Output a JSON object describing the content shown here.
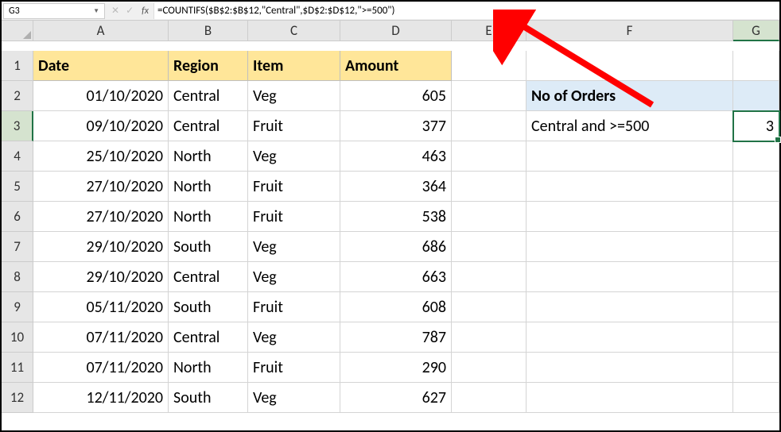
{
  "nameBox": "G3",
  "formula": "=COUNTIFS($B$2:$B$12,\"Central\",$D$2:$D$12,\">=500\")",
  "fxLabel": "fx",
  "cancelIcon": "✕",
  "enterIcon": "✓",
  "columns": [
    "A",
    "B",
    "C",
    "D",
    "E",
    "F",
    "G"
  ],
  "rows": [
    "1",
    "2",
    "3",
    "4",
    "5",
    "6",
    "7",
    "8",
    "9",
    "10",
    "11",
    "12"
  ],
  "headers": {
    "date": "Date",
    "region": "Region",
    "item": "Item",
    "amount": "Amount"
  },
  "data": [
    {
      "date": "01/10/2020",
      "region": "Central",
      "item": "Veg",
      "amount": "605"
    },
    {
      "date": "09/10/2020",
      "region": "Central",
      "item": "Fruit",
      "amount": "377"
    },
    {
      "date": "25/10/2020",
      "region": "North",
      "item": "Veg",
      "amount": "463"
    },
    {
      "date": "27/10/2020",
      "region": "North",
      "item": "Fruit",
      "amount": "364"
    },
    {
      "date": "27/10/2020",
      "region": "North",
      "item": "Fruit",
      "amount": "538"
    },
    {
      "date": "29/10/2020",
      "region": "South",
      "item": "Veg",
      "amount": "686"
    },
    {
      "date": "29/10/2020",
      "region": "Central",
      "item": "Veg",
      "amount": "663"
    },
    {
      "date": "05/11/2020",
      "region": "South",
      "item": "Fruit",
      "amount": "608"
    },
    {
      "date": "07/11/2020",
      "region": "Central",
      "item": "Veg",
      "amount": "787"
    },
    {
      "date": "07/11/2020",
      "region": "North",
      "item": "Fruit",
      "amount": "290"
    },
    {
      "date": "12/11/2020",
      "region": "South",
      "item": "Veg",
      "amount": "627"
    }
  ],
  "side": {
    "title": "No of Orders",
    "label": "Central and >=500",
    "result": "3"
  },
  "selectedCell": "G3"
}
